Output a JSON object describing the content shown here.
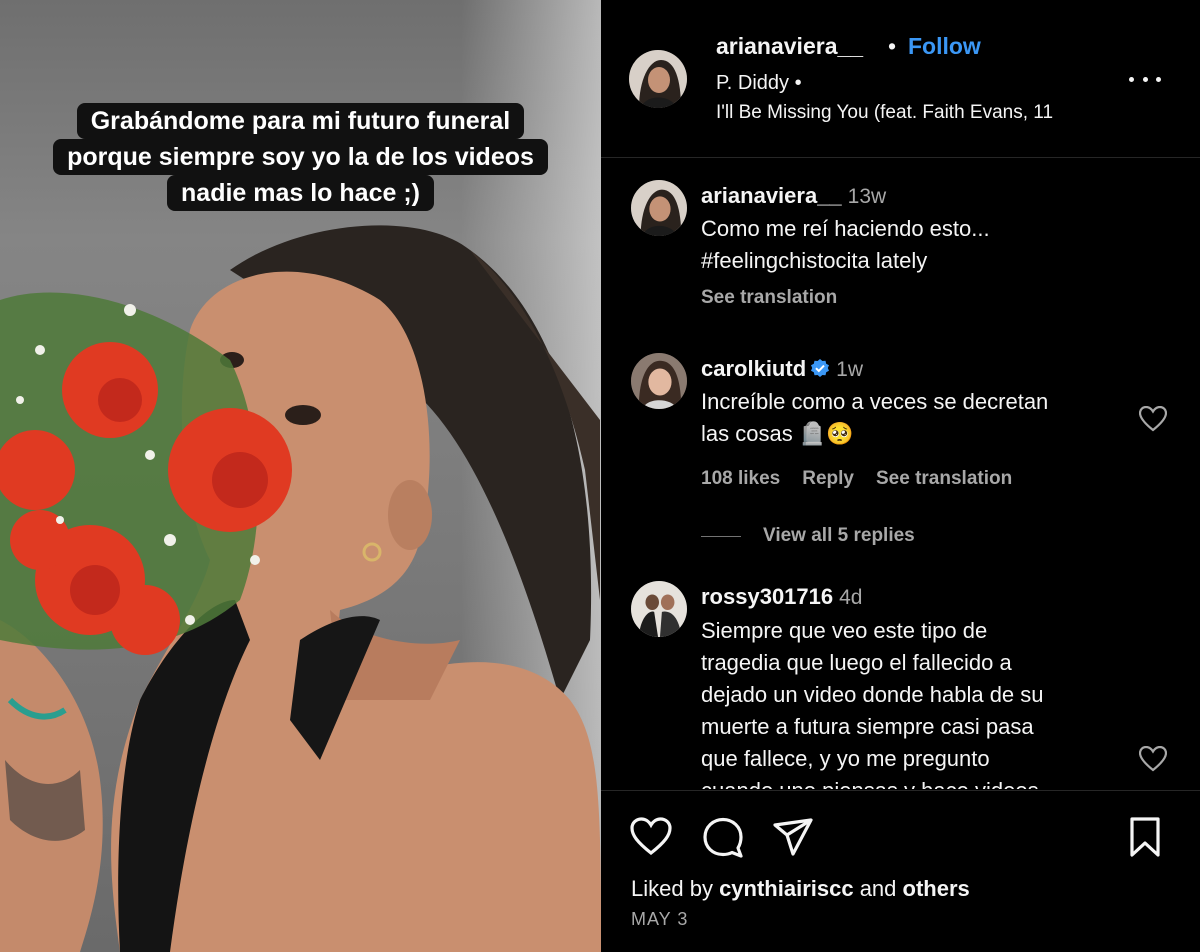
{
  "media": {
    "caption_lines": [
      "Grabándome para mi futuro funeral",
      "porque siempre soy yo la de los videos",
      "nadie mas lo hace ;)"
    ]
  },
  "header": {
    "username": "arianaviera__",
    "separator": "•",
    "follow_label": "Follow",
    "artist": "P. Diddy •",
    "song": "I'll Be Missing You (feat. Faith Evans, 11",
    "more_icon": "more-horizontal-icon"
  },
  "comments": [
    {
      "username": "arianaviera__",
      "time": "13w",
      "text_lines": [
        "Como me reí haciendo esto...",
        "#feelingchistocita lately"
      ],
      "see_translation": "See translation"
    },
    {
      "username": "carolkiutd",
      "verified": true,
      "time": "1w",
      "text_lines": [
        "Increíble como a veces se decretan",
        "las cosas 🪦🥺"
      ],
      "likes": "108 likes",
      "reply": "Reply",
      "see_translation": "See translation",
      "view_replies": "View all 5 replies"
    },
    {
      "username": "rossy301716",
      "time": "4d",
      "text_lines": [
        "Siempre que veo este tipo de",
        "tragedia que luego el fallecido a",
        "dejado un video donde habla de su",
        "muerte a futura siempre casi pasa",
        "que fallece, y yo me pregunto",
        "cuando uno piensas y hace videos"
      ]
    }
  ],
  "footer": {
    "liked_prefix": "Liked by ",
    "liked_user": "cynthiairiscc",
    "liked_mid": " and ",
    "liked_others": "others",
    "date": "MAY 3"
  },
  "colors": {
    "accent": "#3b97f5",
    "secondary_text": "#a8a8a8",
    "background": "#000000"
  }
}
